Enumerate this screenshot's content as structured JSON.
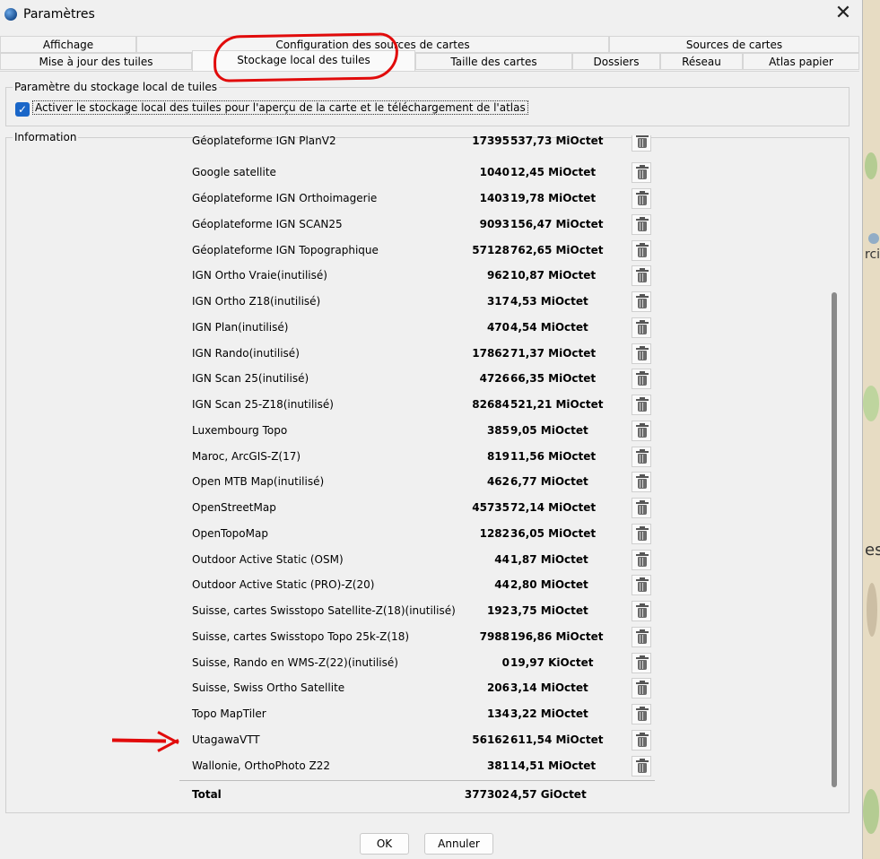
{
  "window": {
    "title": "Paramètres",
    "close_symbol": "✕"
  },
  "tabs_row1": [
    {
      "label": "Affichage"
    },
    {
      "label": "Configuration des sources de cartes"
    },
    {
      "label": "Sources de cartes"
    }
  ],
  "tabs_row2": [
    {
      "label": "Mise à jour des tuiles"
    },
    {
      "label": "Stockage local des tuiles"
    },
    {
      "label": "Taille des cartes"
    },
    {
      "label": "Dossiers"
    },
    {
      "label": "Réseau"
    },
    {
      "label": "Atlas papier"
    }
  ],
  "selected_tab": "Stockage local des tuiles",
  "storage_group": {
    "title": "Paramètre du stockage local de tuiles",
    "checkbox_label": "Activer le stockage local des tuiles pour l'aperçu de la carte et le téléchargement de l'atlas",
    "checkbox_checked": true
  },
  "info_group": {
    "title": "Information"
  },
  "rows": [
    {
      "name": "Géoplateforme IGN PlanV2",
      "count": "17395",
      "size": "537,73 MiOctet"
    },
    {
      "name": "Google satellite",
      "count": "1040",
      "size": "12,45 MiOctet"
    },
    {
      "name": "Géoplateforme IGN Orthoimagerie",
      "count": "1403",
      "size": "19,78 MiOctet"
    },
    {
      "name": "Géoplateforme IGN SCAN25",
      "count": "9093",
      "size": "156,47 MiOctet"
    },
    {
      "name": "Géoplateforme IGN Topographique",
      "count": "57128",
      "size": "762,65 MiOctet"
    },
    {
      "name": "IGN Ortho Vraie(inutilisé)",
      "count": "962",
      "size": "10,87 MiOctet"
    },
    {
      "name": "IGN Ortho Z18(inutilisé)",
      "count": "317",
      "size": "4,53 MiOctet"
    },
    {
      "name": "IGN Plan(inutilisé)",
      "count": "470",
      "size": "4,54 MiOctet"
    },
    {
      "name": "IGN Rando(inutilisé)",
      "count": "17862",
      "size": "71,37 MiOctet"
    },
    {
      "name": "IGN Scan 25(inutilisé)",
      "count": "4726",
      "size": "66,35 MiOctet"
    },
    {
      "name": "IGN Scan 25-Z18(inutilisé)",
      "count": "82684",
      "size": "521,21 MiOctet"
    },
    {
      "name": "Luxembourg Topo",
      "count": "385",
      "size": "9,05 MiOctet"
    },
    {
      "name": "Maroc, ArcGIS-Z(17)",
      "count": "819",
      "size": "11,56 MiOctet"
    },
    {
      "name": "Open MTB Map(inutilisé)",
      "count": "462",
      "size": "6,77 MiOctet"
    },
    {
      "name": "OpenStreetMap",
      "count": "45735",
      "size": "72,14 MiOctet"
    },
    {
      "name": "OpenTopoMap",
      "count": "1282",
      "size": "36,05 MiOctet"
    },
    {
      "name": "Outdoor Active Static (OSM)",
      "count": "44",
      "size": "1,87 MiOctet"
    },
    {
      "name": "Outdoor Active Static (PRO)-Z(20)",
      "count": "44",
      "size": "2,80 MiOctet"
    },
    {
      "name": "Suisse, cartes Swisstopo Satellite-Z(18)(inutilisé)",
      "count": "192",
      "size": "3,75 MiOctet"
    },
    {
      "name": "Suisse, cartes Swisstopo Topo 25k-Z(18)",
      "count": "7988",
      "size": "196,86 MiOctet"
    },
    {
      "name": "Suisse, Rando en WMS-Z(22)(inutilisé)",
      "count": "0",
      "size": "19,97 KiOctet"
    },
    {
      "name": "Suisse, Swiss  Ortho Satellite",
      "count": "206",
      "size": "3,14 MiOctet"
    },
    {
      "name": "Topo MapTiler",
      "count": "134",
      "size": "3,22 MiOctet"
    },
    {
      "name": "UtagawaVTT",
      "count": "56162",
      "size": "611,54 MiOctet"
    },
    {
      "name": "Wallonie, OrthoPhoto Z22",
      "count": "381",
      "size": "14,51 MiOctet"
    }
  ],
  "total": {
    "label": "Total",
    "count": "377302",
    "size": "4,57 GiOctet"
  },
  "buttons": {
    "ok": "OK",
    "cancel": "Annuler"
  },
  "map_edge": {
    "text_top": "rcis",
    "text_mid": "est"
  },
  "colors": {
    "annotation_red": "#e10b0b",
    "checkbox_blue": "#1a66c8",
    "map_bg": "#e7dcc3"
  }
}
